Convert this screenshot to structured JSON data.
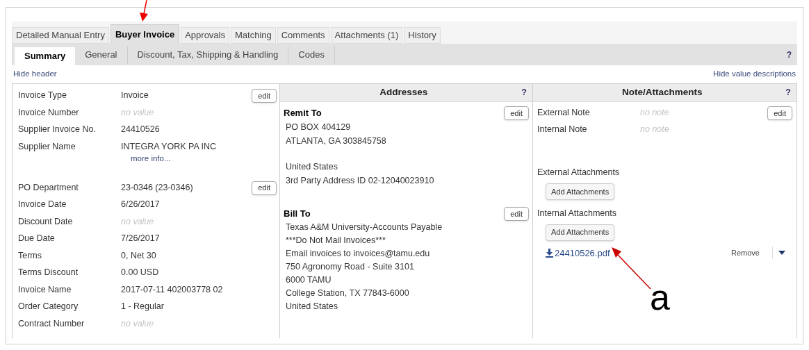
{
  "tabs": [
    {
      "label": "Detailed Manual Entry",
      "selected": false
    },
    {
      "label": "Buyer Invoice",
      "selected": true
    },
    {
      "label": "Approvals",
      "selected": false
    },
    {
      "label": "Matching",
      "selected": false
    },
    {
      "label": "Comments",
      "selected": false
    },
    {
      "label": "Attachments (1)",
      "selected": false
    },
    {
      "label": "History",
      "selected": false
    }
  ],
  "subtabs": [
    {
      "label": "Summary",
      "selected": true
    },
    {
      "label": "General",
      "selected": false
    },
    {
      "label": "Discount, Tax, Shipping & Handling",
      "selected": false
    },
    {
      "label": "Codes",
      "selected": false
    }
  ],
  "help_mark": "?",
  "hide_header": "Hide header",
  "hide_value_descriptions": "Hide value descriptions",
  "header_fields": {
    "groups": [
      {
        "edit": "edit",
        "rows": [
          {
            "label": "Invoice Type",
            "value": "Invoice",
            "empty": false
          },
          {
            "label": "Invoice Number",
            "value": "no value",
            "empty": true
          },
          {
            "label": "Supplier Invoice No.",
            "value": "24410526",
            "empty": false
          },
          {
            "label": "Supplier Name",
            "value": "INTEGRA YORK PA INC",
            "empty": false,
            "link": "more info..."
          }
        ]
      },
      {
        "edit": "edit",
        "rows": [
          {
            "label": "PO Department",
            "value": "23-0346 (23-0346)",
            "empty": false
          },
          {
            "label": "Invoice Date",
            "value": "6/26/2017",
            "empty": false
          },
          {
            "label": "Discount Date",
            "value": "no value",
            "empty": true
          },
          {
            "label": "Due Date",
            "value": "7/26/2017",
            "empty": false
          },
          {
            "label": "Terms",
            "value": "0, Net 30",
            "empty": false
          },
          {
            "label": "Terms Discount",
            "value": "0.00 USD",
            "empty": false
          },
          {
            "label": "Invoice Name",
            "value": "2017-07-11 402003778 02",
            "empty": false
          },
          {
            "label": "Order Category",
            "value": "1 - Regular",
            "empty": false
          },
          {
            "label": "Contract Number",
            "value": "no value",
            "empty": true
          }
        ]
      }
    ]
  },
  "addresses": {
    "title": "Addresses",
    "help": "?",
    "blocks": [
      {
        "title": "Remit To",
        "edit": "edit",
        "paragraphs": [
          [
            "PO BOX 404129",
            "ATLANTA, GA 303845758"
          ],
          [
            "United States",
            "3rd Party Address ID 02-12040023910"
          ]
        ]
      },
      {
        "title": "Bill To",
        "edit": "edit",
        "paragraphs": [
          [
            "Texas A&M University-Accounts Payable",
            "***Do Not Mail Invoices***",
            "Email invoices to invoices@tamu.edu",
            "750 Agronomy Road - Suite 3101",
            "6000 TAMU",
            "College Station, TX 77843-6000",
            "United States"
          ]
        ]
      }
    ]
  },
  "notes": {
    "title": "Note/Attachments",
    "help": "?",
    "edit": "edit",
    "rows": [
      {
        "label": "External Note",
        "value": "no note",
        "empty": true
      },
      {
        "label": "Internal Note",
        "value": "no note",
        "empty": true
      }
    ],
    "external_attachments": {
      "label": "External Attachments",
      "button": "Add Attachments"
    },
    "internal_attachments": {
      "label": "Internal Attachments",
      "button": "Add Attachments"
    },
    "files": [
      {
        "name": "24410526.pdf",
        "action": "Remove"
      }
    ]
  },
  "annotation_label": "a"
}
